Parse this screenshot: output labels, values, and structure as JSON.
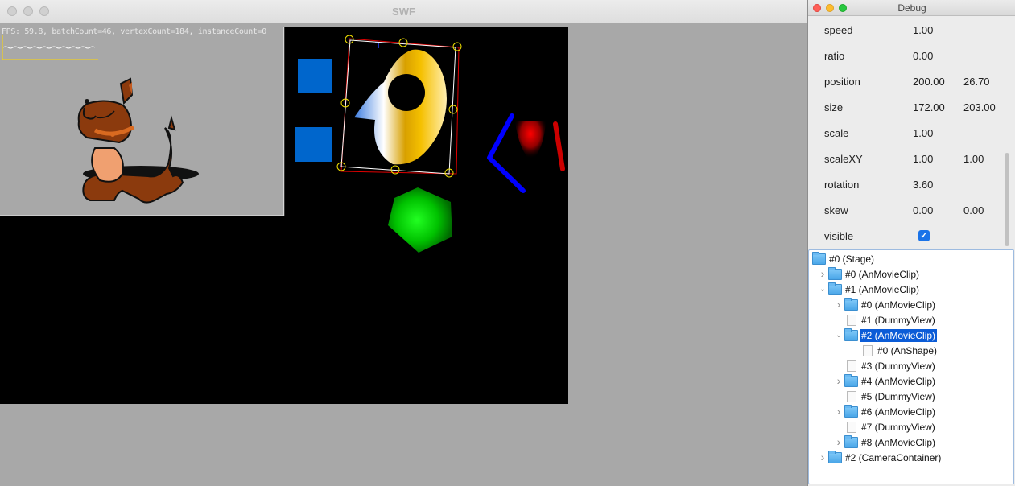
{
  "swf": {
    "title": "SWF",
    "stats": "FPS: 59.8, batchCount=46, vertexCount=184, instanceCount=0"
  },
  "debug": {
    "title": "Debug",
    "props": [
      {
        "label": "speed",
        "v1": "1.00",
        "v2": ""
      },
      {
        "label": "ratio",
        "v1": "0.00",
        "v2": ""
      },
      {
        "label": "position",
        "v1": "200.00",
        "v2": "26.70"
      },
      {
        "label": "size",
        "v1": "172.00",
        "v2": "203.00"
      },
      {
        "label": "scale",
        "v1": "1.00",
        "v2": ""
      },
      {
        "label": "scaleXY",
        "v1": "1.00",
        "v2": "1.00"
      },
      {
        "label": "rotation",
        "v1": "3.60",
        "v2": ""
      },
      {
        "label": "skew",
        "v1": "0.00",
        "v2": "0.00"
      },
      {
        "label": "visible",
        "v1": "",
        "v2": ""
      }
    ],
    "visible_checked": true,
    "tree": [
      {
        "label": "#0 (Stage)",
        "icon": "folder-icon",
        "arrow": "",
        "depth": 0,
        "selected": false
      },
      {
        "label": "#0 (AnMovieClip)",
        "icon": "folder-icon",
        "arrow": "collapsed",
        "depth": 1,
        "selected": false
      },
      {
        "label": "#1 (AnMovieClip)",
        "icon": "folder-icon",
        "arrow": "expanded",
        "depth": 1,
        "selected": false
      },
      {
        "label": "#0 (AnMovieClip)",
        "icon": "folder-icon",
        "arrow": "collapsed",
        "depth": 2,
        "selected": false
      },
      {
        "label": "#1 (DummyView)",
        "icon": "file-icon",
        "arrow": "",
        "depth": 2,
        "selected": false
      },
      {
        "label": "#2 (AnMovieClip)",
        "icon": "folder-icon",
        "arrow": "expanded",
        "depth": 2,
        "selected": true
      },
      {
        "label": "#0 (AnShape)",
        "icon": "file-icon",
        "arrow": "",
        "depth": 3,
        "selected": false
      },
      {
        "label": "#3 (DummyView)",
        "icon": "file-icon",
        "arrow": "",
        "depth": 2,
        "selected": false
      },
      {
        "label": "#4 (AnMovieClip)",
        "icon": "folder-icon",
        "arrow": "collapsed",
        "depth": 2,
        "selected": false
      },
      {
        "label": "#5 (DummyView)",
        "icon": "file-icon",
        "arrow": "",
        "depth": 2,
        "selected": false
      },
      {
        "label": "#6 (AnMovieClip)",
        "icon": "folder-icon",
        "arrow": "collapsed",
        "depth": 2,
        "selected": false
      },
      {
        "label": "#7 (DummyView)",
        "icon": "file-icon",
        "arrow": "",
        "depth": 2,
        "selected": false
      },
      {
        "label": "#8 (AnMovieClip)",
        "icon": "folder-icon",
        "arrow": "collapsed",
        "depth": 2,
        "selected": false
      },
      {
        "label": "#2 (CameraContainer)",
        "icon": "folder-icon",
        "arrow": "collapsed",
        "depth": 1,
        "selected": false
      }
    ]
  },
  "colors": {
    "selection": "#0b5cd7",
    "stage_bg": "#000000",
    "square_blue": "#0066cc",
    "pentagon_green": "#00d000",
    "bounds_red": "#e00000"
  },
  "arrows": {
    "collapsed": "›",
    "expanded": "⌄"
  }
}
